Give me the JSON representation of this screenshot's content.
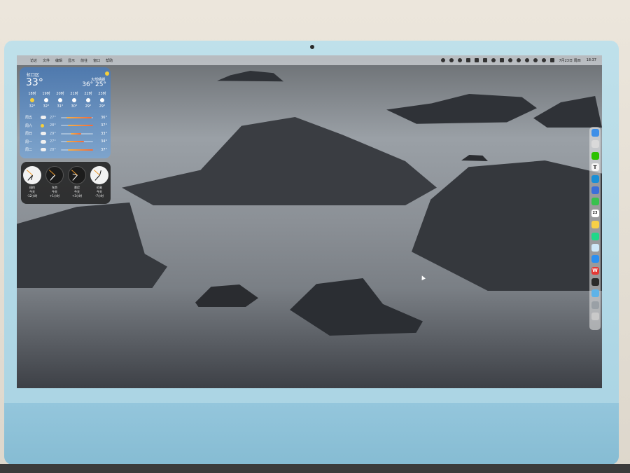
{
  "menubar": {
    "apple": "",
    "items": [
      "访达",
      "文件",
      "编辑",
      "显示",
      "前往",
      "窗口",
      "帮助"
    ],
    "date": "7月23日 周四",
    "time": "18:37"
  },
  "weather": {
    "location": "虹口区",
    "current_temp": "33°",
    "condition": "大部晴朗",
    "hi": "36°",
    "lo": "25°",
    "hourly": [
      {
        "time": "18时",
        "temp": "32°",
        "icon": "sun-icon"
      },
      {
        "time": "19时",
        "temp": "32°",
        "icon": "moon-icon"
      },
      {
        "time": "20时",
        "temp": "31°",
        "icon": "moon-icon"
      },
      {
        "time": "21时",
        "temp": "30°",
        "icon": "moon-icon"
      },
      {
        "time": "22时",
        "temp": "29°",
        "icon": "moon-icon"
      },
      {
        "time": "23时",
        "temp": "29°",
        "icon": "moon-icon"
      }
    ],
    "daily": [
      {
        "day": "周五",
        "lo": "27°",
        "hi": "36°",
        "icon": "partly-cloudy-icon",
        "bar_start": 0.18,
        "bar_end": 0.95
      },
      {
        "day": "周六",
        "lo": "28°",
        "hi": "37°",
        "icon": "sun-icon",
        "bar_start": 0.22,
        "bar_end": 1.0
      },
      {
        "day": "周日",
        "lo": "29°",
        "hi": "33°",
        "icon": "partly-cloudy-icon",
        "bar_start": 0.3,
        "bar_end": 0.62
      },
      {
        "day": "周一",
        "lo": "27°",
        "hi": "34°",
        "icon": "partly-cloudy-icon",
        "bar_start": 0.18,
        "bar_end": 0.72
      },
      {
        "day": "周二",
        "lo": "28°",
        "hi": "37°",
        "icon": "cloud-icon",
        "bar_start": 0.22,
        "bar_end": 1.0
      }
    ]
  },
  "clocks": [
    {
      "city": "纽约",
      "day": "今天",
      "offset": "-12小时",
      "face": "light",
      "hour_deg": 195,
      "min_deg": 222
    },
    {
      "city": "东京",
      "day": "今天",
      "offset": "+1小时",
      "face": "dark",
      "hour_deg": 225,
      "min_deg": 222
    },
    {
      "city": "悉尼",
      "day": "今天",
      "offset": "+3小时",
      "face": "dark",
      "hour_deg": 285,
      "min_deg": 222
    },
    {
      "city": "伦敦",
      "day": "今天",
      "offset": "-7小时",
      "face": "light",
      "hour_deg": 15,
      "min_deg": 222
    }
  ],
  "dock": [
    {
      "name": "finder-icon",
      "color": "#3d8fe8",
      "glyph": ""
    },
    {
      "name": "launchpad-icon",
      "color": "#d9d9d9",
      "glyph": ""
    },
    {
      "name": "wechat-icon",
      "color": "#2dc100",
      "glyph": ""
    },
    {
      "name": "typora-icon",
      "color": "#f5f5f5",
      "glyph": "T"
    },
    {
      "name": "edge-icon",
      "color": "#1a8fd6",
      "glyph": ""
    },
    {
      "name": "apps-grid-icon",
      "color": "#3b6fd9",
      "glyph": ""
    },
    {
      "name": "facetime-icon",
      "color": "#38c14e",
      "glyph": ""
    },
    {
      "name": "calendar-icon",
      "color": "#ffffff",
      "glyph": "23"
    },
    {
      "name": "notes-icon",
      "color": "#f7d046",
      "glyph": ""
    },
    {
      "name": "pycharm-icon",
      "color": "#21d789",
      "glyph": ""
    },
    {
      "name": "preview-icon",
      "color": "#cfe8f7",
      "glyph": ""
    },
    {
      "name": "mail-icon",
      "color": "#2b8ff0",
      "glyph": ""
    },
    {
      "name": "wps-icon",
      "color": "#e53935",
      "glyph": "W"
    },
    {
      "name": "terminal-icon",
      "color": "#2b2b2b",
      "glyph": ""
    },
    {
      "name": "downloads-folder-icon",
      "color": "#5fb3e8",
      "glyph": ""
    },
    {
      "name": "files-folder-icon",
      "color": "#9aa0a6",
      "glyph": ""
    },
    {
      "name": "trash-icon",
      "color": "#c9c9c9",
      "glyph": ""
    }
  ]
}
